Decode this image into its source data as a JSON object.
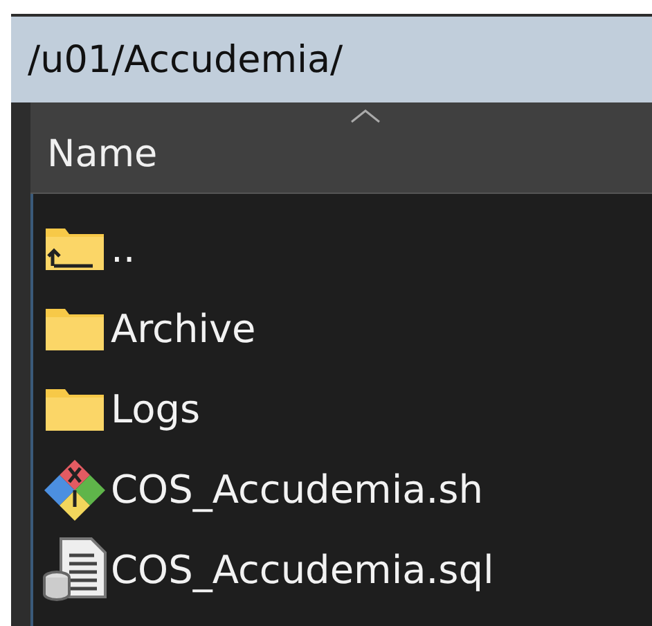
{
  "path_bar": {
    "path": "/u01/Accudemia/"
  },
  "columns": [
    {
      "label": "Name",
      "sort_ascending": true
    }
  ],
  "files": [
    {
      "name": "..",
      "kind": "parent"
    },
    {
      "name": "Archive",
      "kind": "folder"
    },
    {
      "name": "Logs",
      "kind": "folder"
    },
    {
      "name": "COS_Accudemia.sh",
      "kind": "script"
    },
    {
      "name": "COS_Accudemia.sql",
      "kind": "sql"
    }
  ]
}
